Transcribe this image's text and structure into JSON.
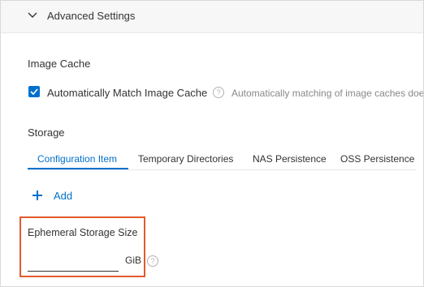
{
  "panel": {
    "title": "Advanced Settings"
  },
  "image_cache": {
    "section_label": "Image Cache",
    "checkbox_label": "Automatically Match Image Cache",
    "checked": true,
    "description": "Automatically matching of image caches doe"
  },
  "storage": {
    "section_label": "Storage",
    "tabs": [
      {
        "label": "Configuration Item",
        "active": true
      },
      {
        "label": "Temporary Directories",
        "active": false
      },
      {
        "label": "NAS Persistence",
        "active": false
      },
      {
        "label": "OSS Persistence",
        "active": false
      }
    ],
    "add_label": "Add",
    "ephemeral": {
      "label": "Ephemeral Storage Size",
      "value": "",
      "unit": "GiB"
    }
  },
  "colors": {
    "accent": "#0070cc",
    "highlight": "#e25a2c",
    "header_bg": "#f7f7f7"
  },
  "icons": [
    "chevron-down-icon",
    "check-icon",
    "help-icon",
    "plus-icon"
  ]
}
